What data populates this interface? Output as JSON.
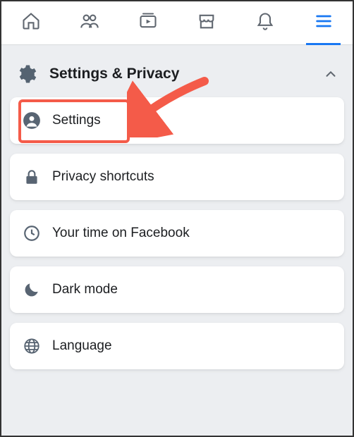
{
  "colors": {
    "accent": "#1877f2",
    "highlight": "#f45b49"
  },
  "section": {
    "title": "Settings & Privacy",
    "icon": "gear-icon"
  },
  "items": [
    {
      "icon": "profile-circle-icon",
      "label": "Settings",
      "highlighted": true
    },
    {
      "icon": "lock-icon",
      "label": "Privacy shortcuts"
    },
    {
      "icon": "clock-icon",
      "label": "Your time on Facebook"
    },
    {
      "icon": "moon-icon",
      "label": "Dark mode"
    },
    {
      "icon": "globe-icon",
      "label": "Language"
    }
  ],
  "nav": {
    "active": "menu",
    "tabs": [
      "home",
      "friends",
      "watch",
      "marketplace",
      "notifications",
      "menu"
    ]
  }
}
